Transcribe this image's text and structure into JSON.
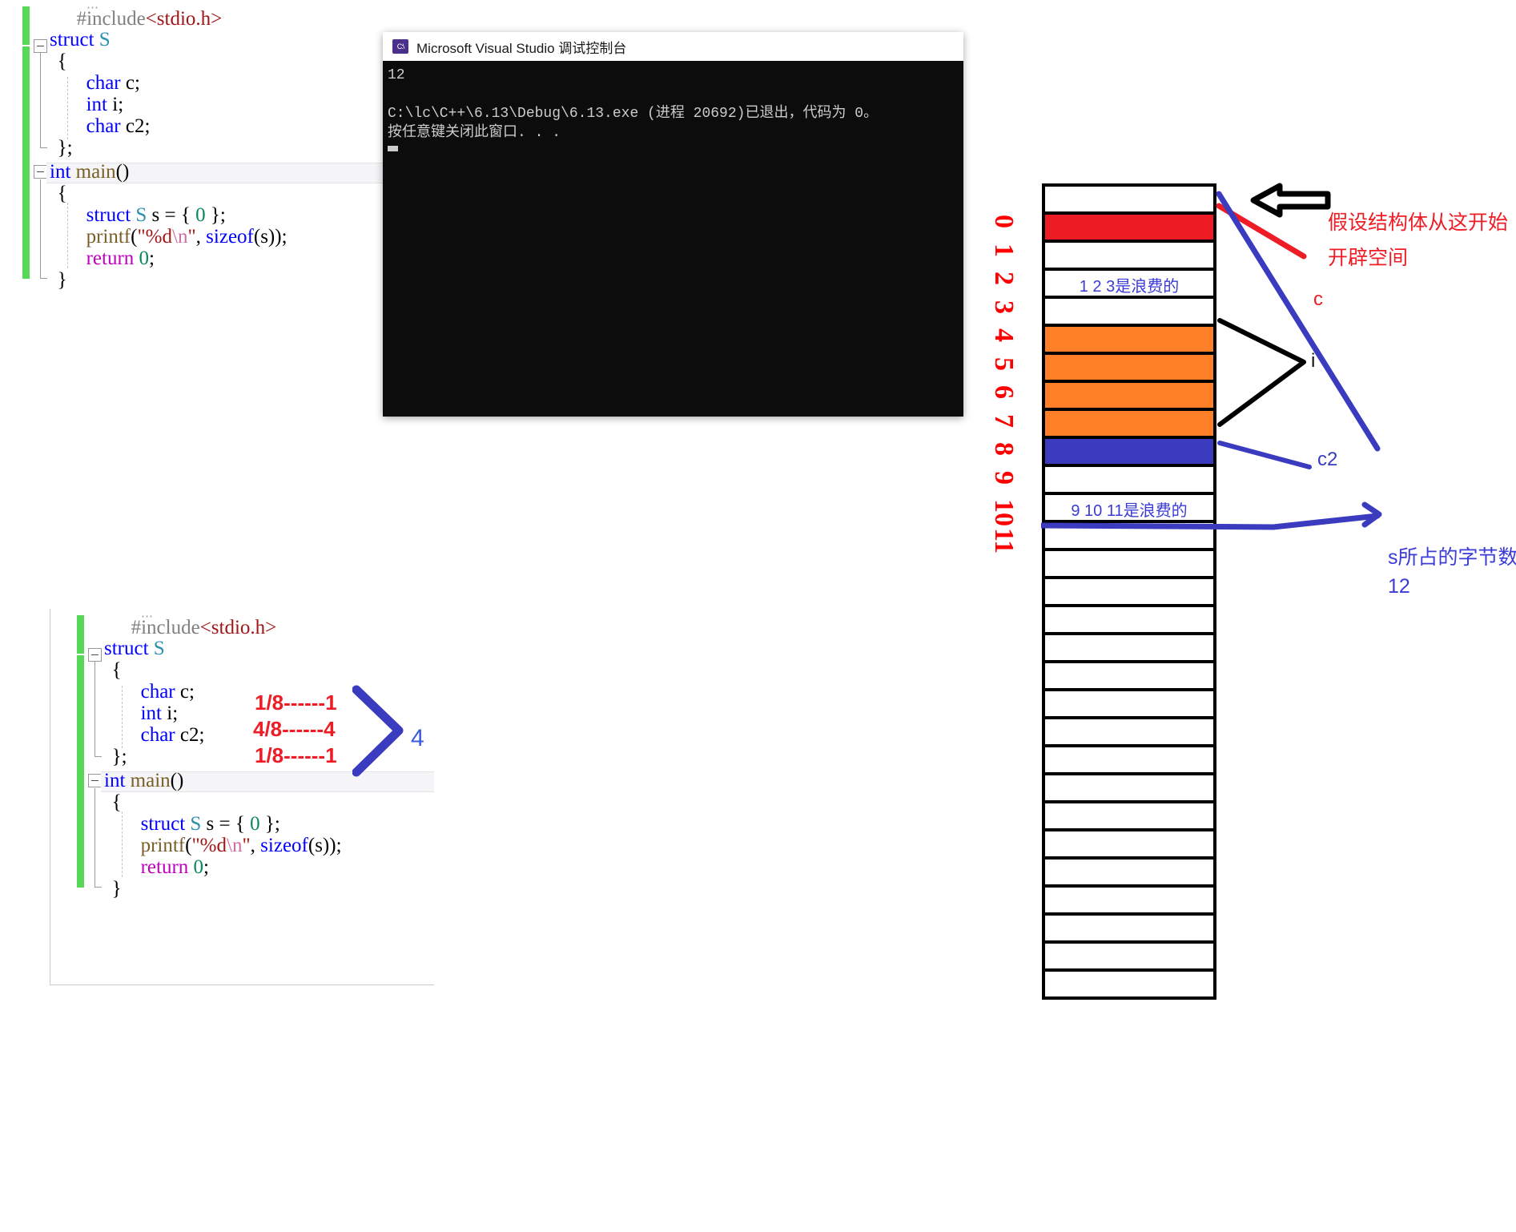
{
  "top_editor": {
    "name": "visual-studio-code-editor-top",
    "lines": [
      {
        "id": "l1",
        "text": "#include<stdio.h>",
        "parts": [
          {
            "t": "#include",
            "c": "pre"
          },
          {
            "t": "<stdio.h>",
            "c": "str"
          }
        ]
      },
      {
        "id": "l2",
        "text": "struct S",
        "parts": [
          {
            "t": "struct ",
            "c": "kw"
          },
          {
            "t": "S",
            "c": "typ"
          }
        ]
      },
      {
        "id": "l3",
        "text": "{",
        "parts": [
          {
            "t": "{",
            "c": "id"
          }
        ]
      },
      {
        "id": "l4",
        "text": "char c;",
        "parts": [
          {
            "t": "char",
            "c": "kw"
          },
          {
            "t": " c;",
            "c": "id"
          }
        ]
      },
      {
        "id": "l5",
        "text": "int i;",
        "parts": [
          {
            "t": "int",
            "c": "kw"
          },
          {
            "t": " i;",
            "c": "id"
          }
        ]
      },
      {
        "id": "l6",
        "text": "char c2;",
        "parts": [
          {
            "t": "char",
            "c": "kw"
          },
          {
            "t": " c2;",
            "c": "id"
          }
        ]
      },
      {
        "id": "l7",
        "text": "};",
        "parts": [
          {
            "t": "};",
            "c": "id"
          }
        ]
      },
      {
        "id": "l8",
        "text": "int main()",
        "parts": [
          {
            "t": "int",
            "c": "kw"
          },
          {
            "t": " ",
            "c": "id"
          },
          {
            "t": "main",
            "c": "fn"
          },
          {
            "t": "()",
            "c": "id"
          }
        ]
      },
      {
        "id": "l9",
        "text": "{",
        "parts": [
          {
            "t": "{",
            "c": "id"
          }
        ]
      },
      {
        "id": "l10",
        "text": "struct S s = { 0 };",
        "parts": [
          {
            "t": "struct ",
            "c": "kw"
          },
          {
            "t": "S",
            "c": "typ"
          },
          {
            "t": " s = { ",
            "c": "id"
          },
          {
            "t": "0",
            "c": "num"
          },
          {
            "t": " };",
            "c": "id"
          }
        ]
      },
      {
        "id": "l11",
        "text": "printf(\"%d\\n\", sizeof(s));",
        "parts": [
          {
            "t": "printf",
            "c": "fn"
          },
          {
            "t": "(",
            "c": "id"
          },
          {
            "t": "\"%d",
            "c": "str"
          },
          {
            "t": "\\n",
            "c": "esc"
          },
          {
            "t": "\"",
            "c": "str"
          },
          {
            "t": ", ",
            "c": "id"
          },
          {
            "t": "sizeof",
            "c": "kw"
          },
          {
            "t": "(s));",
            "c": "id"
          }
        ]
      },
      {
        "id": "l12",
        "text": "return 0;",
        "parts": [
          {
            "t": "return",
            "c": "pink"
          },
          {
            "t": " ",
            "c": "id"
          },
          {
            "t": "0",
            "c": "num"
          },
          {
            "t": ";",
            "c": "id"
          }
        ]
      },
      {
        "id": "l13",
        "text": "}",
        "parts": [
          {
            "t": "}",
            "c": "id"
          }
        ]
      }
    ]
  },
  "console": {
    "title": "Microsoft Visual Studio 调试控制台",
    "icon": "console-app-icon",
    "icon_text": "C:\\",
    "lines": [
      "12",
      "",
      "C:\\lc\\C++\\6.13\\Debug\\6.13.exe (进程 20692)已退出，代码为 0。",
      "按任意键关闭此窗口. . ."
    ]
  },
  "bottom_editor": {
    "name": "visual-studio-code-editor-bottom",
    "annotations": {
      "c_size": "1/8------1",
      "i_size": "4/8------4",
      "c2_size": "1/8------1",
      "alignment": "4",
      "bracket": "blue-brace-bracket"
    }
  },
  "memory_diagram": {
    "title": "struct-memory-layout",
    "offset_labels": [
      "0",
      "1",
      "2",
      "3",
      "4",
      "5",
      "6",
      "7",
      "8",
      "9",
      "10",
      "11"
    ],
    "cells": [
      {
        "index": -1,
        "color": "#ffffff",
        "label": ""
      },
      {
        "index": 0,
        "color": "#ed1c24",
        "label": ""
      },
      {
        "index": 1,
        "color": "#ffffff",
        "label": ""
      },
      {
        "index": 2,
        "color": "#ffffff",
        "label": "1 2 3是浪费的"
      },
      {
        "index": 3,
        "color": "#ffffff",
        "label": ""
      },
      {
        "index": 4,
        "color": "#ff7f27",
        "label": ""
      },
      {
        "index": 5,
        "color": "#ff7f27",
        "label": ""
      },
      {
        "index": 6,
        "color": "#ff7f27",
        "label": ""
      },
      {
        "index": 7,
        "color": "#ff7f27",
        "label": ""
      },
      {
        "index": 8,
        "color": "#3b3bbf",
        "label": ""
      },
      {
        "index": 9,
        "color": "#ffffff",
        "label": ""
      },
      {
        "index": 10,
        "color": "#ffffff",
        "label": "9 10 11是浪费的"
      },
      {
        "index": 11,
        "color": "#ffffff",
        "label": ""
      }
    ],
    "extra_empty_cells": 16,
    "colors": {
      "member_c": "#ed1c24",
      "member_i": "#ff7f27",
      "member_c2": "#3b3bbf",
      "waste": "#ffffff",
      "border": "#000000"
    },
    "annotations": {
      "start_note_line1": "假设结构体从这开始",
      "start_note_line2": "开辟空间",
      "member_c": "c",
      "member_i": "i",
      "member_c2": "c2",
      "total_note_line1": "s所占的字节数",
      "total_note_line2": "12"
    }
  }
}
